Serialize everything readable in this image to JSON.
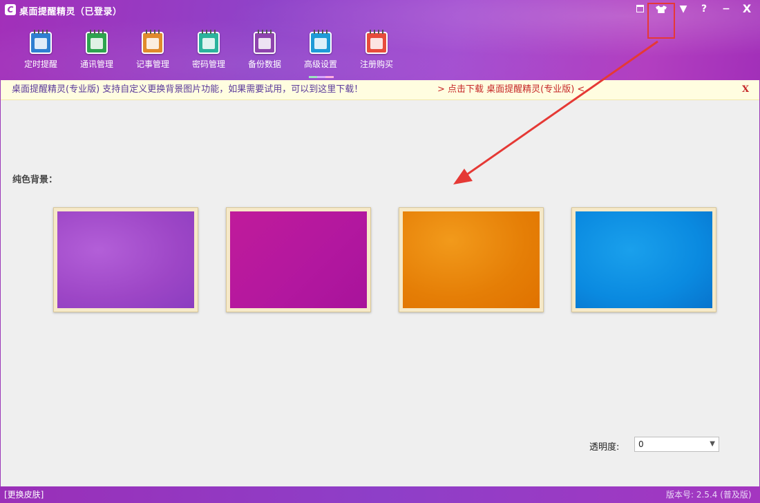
{
  "window": {
    "title": "桌面提醒精灵（已登录）",
    "logo_glyph": "C",
    "controls": {
      "menu_glyph": "▼",
      "help_glyph": "?",
      "minimize_glyph": "−",
      "close_glyph": "X"
    }
  },
  "toolbar": {
    "items": [
      {
        "label": "定时提醒",
        "icon": "alarm-clock-icon",
        "color": "#2f7fd1"
      },
      {
        "label": "通讯管理",
        "icon": "contacts-icon",
        "color": "#2ea44f"
      },
      {
        "label": "记事管理",
        "icon": "notepad-icon",
        "color": "#e08a2c"
      },
      {
        "label": "密码管理",
        "icon": "lock-icon",
        "color": "#2bb39c"
      },
      {
        "label": "备份数据",
        "icon": "disk-icon",
        "color": "#8e44ad"
      },
      {
        "label": "高级设置",
        "icon": "gear-icon",
        "color": "#1e9bd7"
      },
      {
        "label": "注册购买",
        "icon": "cart-icon",
        "color": "#e74c3c"
      }
    ],
    "active_index": 5
  },
  "notice": {
    "text": "桌面提醒精灵(专业版) 支持自定义更换背景图片功能，如果需要试用，可以到这里下载！",
    "link": "> 点击下载 桌面提醒精灵(专业版) <",
    "close": "X"
  },
  "content": {
    "section_label": "纯色背景：",
    "swatches": [
      {
        "name": "purple",
        "color": "#9d46c6"
      },
      {
        "name": "magenta",
        "color": "#b2179f"
      },
      {
        "name": "orange",
        "color": "#e57e06"
      },
      {
        "name": "blue",
        "color": "#0a8ae0"
      }
    ],
    "annotation_color": "#e53935"
  },
  "opacity": {
    "label": "透明度:",
    "value": "0"
  },
  "status_bar": {
    "skin_link": "[更换皮肤]",
    "version": "版本号: 2.5.4 (普及版)"
  }
}
